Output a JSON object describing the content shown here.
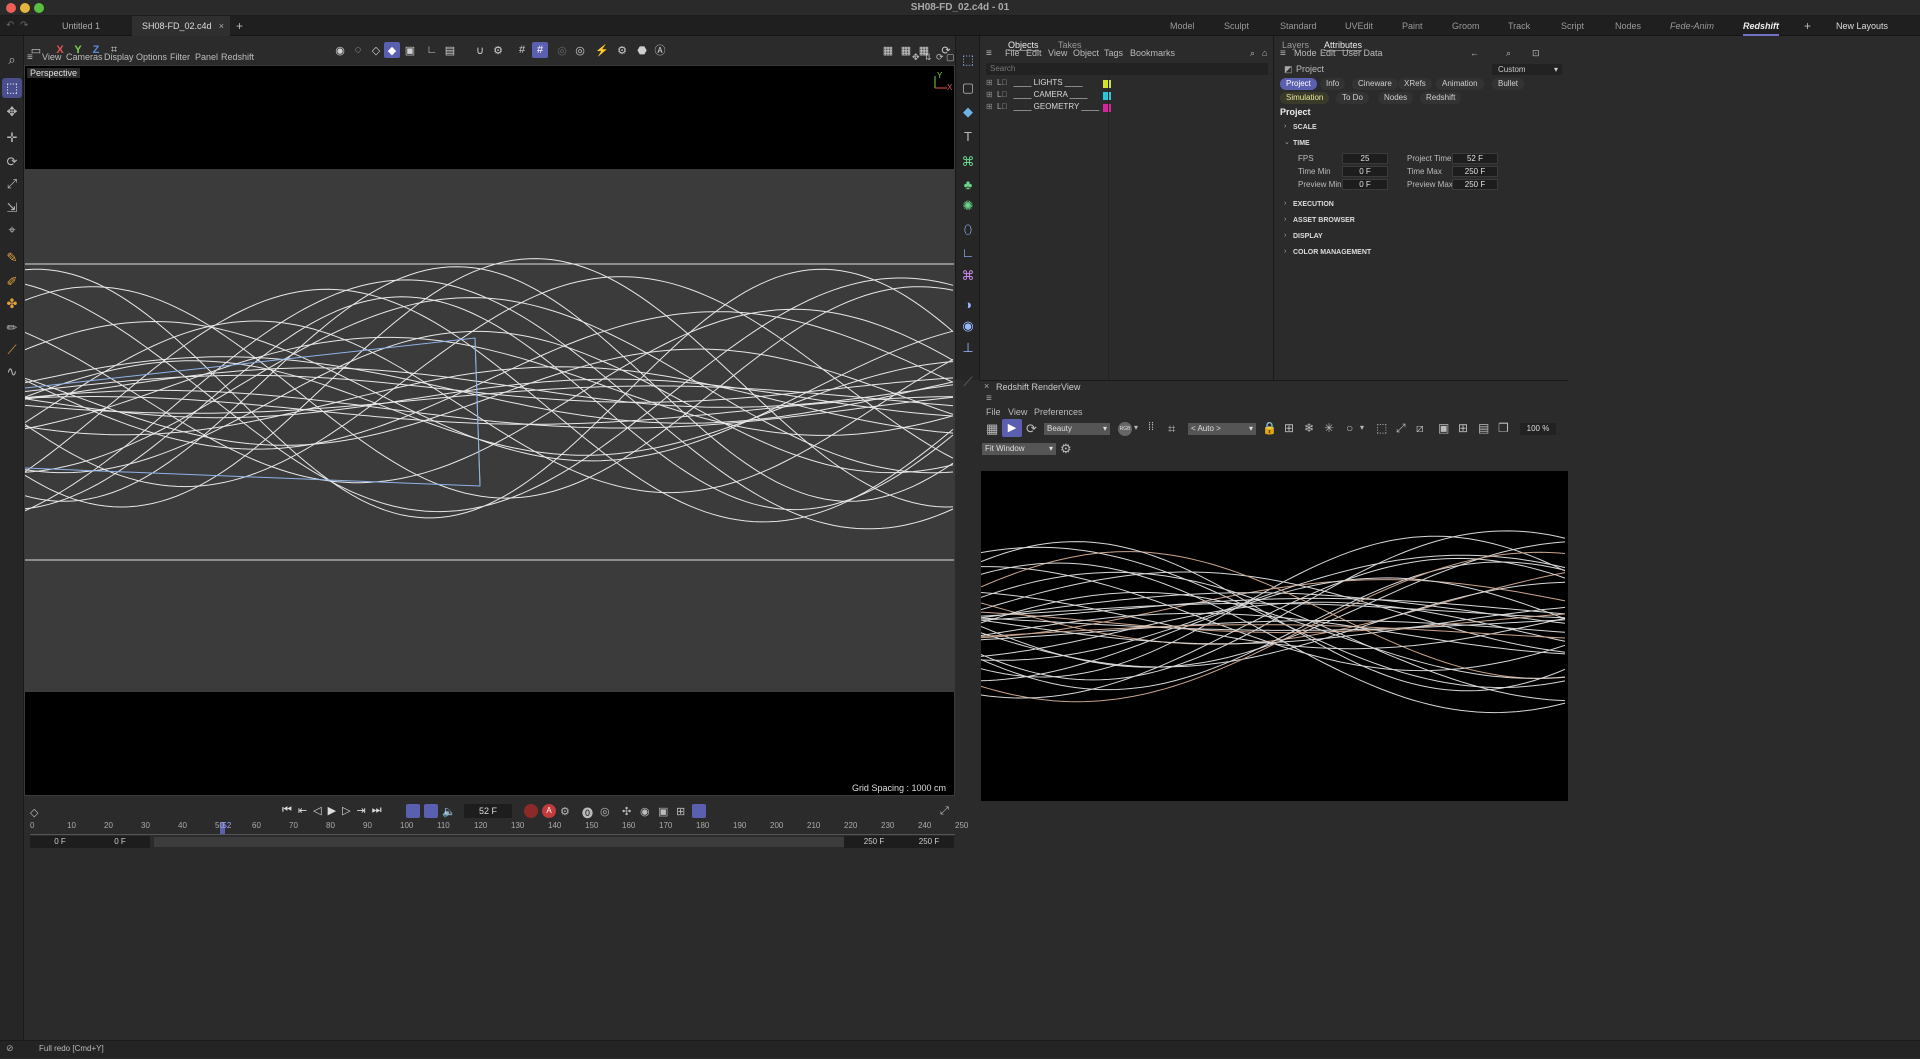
{
  "window": {
    "title": "SH08-FD_02.c4d - 01"
  },
  "doc_tabs": [
    {
      "label": "Untitled 1",
      "active": false
    },
    {
      "label": "SH08-FD_02.c4d",
      "active": true
    }
  ],
  "layout_tabs": [
    "Model",
    "Sculpt",
    "Standard",
    "UVEdit",
    "Paint",
    "Groom",
    "Track",
    "Script",
    "Nodes",
    "Fede-Anim",
    "Redshift"
  ],
  "new_layouts": "New Layouts",
  "axis_lock": [
    "X",
    "Y",
    "Z"
  ],
  "viewport": {
    "menu": [
      "View",
      "Cameras",
      "Display",
      "Options",
      "Filter",
      "Panel",
      "Redshift"
    ],
    "label": "Perspective",
    "grid_spacing": "Grid Spacing : 1000 cm"
  },
  "timeline": {
    "current_frame": "52 F",
    "ruler": [
      "0",
      "10",
      "20",
      "30",
      "40",
      "50",
      "52",
      "60",
      "70",
      "80",
      "90",
      "100",
      "110",
      "120",
      "130",
      "140",
      "150",
      "160",
      "170",
      "180",
      "190",
      "200",
      "210",
      "220",
      "230",
      "240",
      "250"
    ],
    "start_field": "0 F",
    "min_field": "0 F",
    "max_field": "250 F",
    "end_field": "250 F"
  },
  "objects_panel": {
    "tabs": [
      "Objects",
      "Takes"
    ],
    "menu": [
      "File",
      "Edit",
      "View",
      "Object",
      "Tags",
      "Bookmarks"
    ],
    "search_placeholder": "Search",
    "rows": [
      {
        "name": "____ LIGHTS ____",
        "color": "#d4e02a"
      },
      {
        "name": "____ CAMERA ____",
        "color": "#27c8d8"
      },
      {
        "name": "____ GEOMETRY ____",
        "color": "#d3269c"
      }
    ]
  },
  "attributes_panel": {
    "tabs": [
      "Layers",
      "Attributes"
    ],
    "menu": [
      "Mode",
      "Edit",
      "User Data"
    ],
    "object_name": "Project",
    "preset": "Custom",
    "buttons_row1": [
      "Project",
      "Info",
      "Cineware",
      "XRefs",
      "Animation",
      "Bullet"
    ],
    "buttons_row2": [
      "Simulation",
      "To Do",
      "Nodes",
      "Redshift"
    ],
    "heading": "Project",
    "sections": [
      "SCALE",
      "TIME",
      "EXECUTION",
      "ASSET BROWSER",
      "DISPLAY",
      "COLOR MANAGEMENT"
    ],
    "time_fields": [
      {
        "label": "FPS",
        "value": "25"
      },
      {
        "label": "Project Time",
        "value": "52 F"
      },
      {
        "label": "Time Min",
        "value": "0 F"
      },
      {
        "label": "Time Max",
        "value": "250 F"
      },
      {
        "label": "Preview Min",
        "value": "0 F"
      },
      {
        "label": "Preview Max",
        "value": "250 F"
      }
    ]
  },
  "renderview": {
    "title": "Redshift RenderView",
    "menu": [
      "File",
      "View",
      "Preferences"
    ],
    "aov": "Beauty",
    "camera": "< Auto >",
    "zoom": "100 %",
    "fit": "Fit Window",
    "rgb": "RGB"
  },
  "status": {
    "message": "Full redo [Cmd+Y]"
  }
}
